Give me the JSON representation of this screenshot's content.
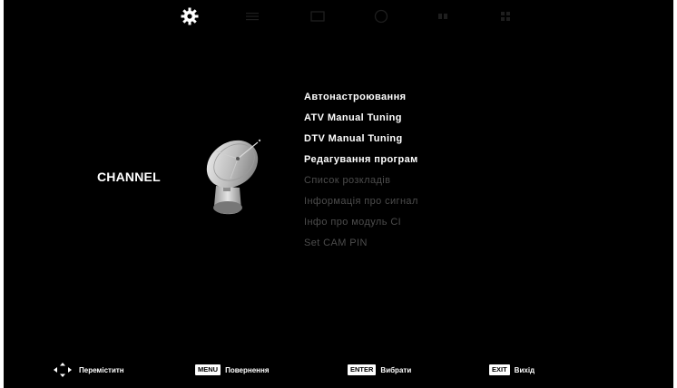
{
  "category": {
    "label": "CHANNEL"
  },
  "top_tabs": [
    {
      "icon": "gear-icon",
      "active": true
    },
    {
      "icon": "list-icon",
      "active": false
    },
    {
      "icon": "screen-icon",
      "active": false
    },
    {
      "icon": "circle-icon",
      "active": false
    },
    {
      "icon": "pair-icon",
      "active": false
    },
    {
      "icon": "grid-icon",
      "active": false
    }
  ],
  "menu": {
    "items": [
      {
        "label": "Автонастроювання",
        "enabled": true
      },
      {
        "label": "ATV Manual Tuning",
        "enabled": true
      },
      {
        "label": "DTV Manual Tuning",
        "enabled": true
      },
      {
        "label": "Редагування програм",
        "enabled": true
      },
      {
        "label": "Список розкладів",
        "enabled": false
      },
      {
        "label": "Інформація про сигнал",
        "enabled": false
      },
      {
        "label": "Інфо про модуль CI",
        "enabled": false
      },
      {
        "label": "Set CAM PIN",
        "enabled": false
      }
    ]
  },
  "footer": {
    "move": {
      "label": "Переміститн",
      "icon": "arrows-icon"
    },
    "menu": {
      "key": "MENU",
      "label": "Повернення"
    },
    "enter": {
      "key": "ENTER",
      "label": "Вибрати"
    },
    "exit": {
      "key": "EXIT",
      "label": "Вихід"
    }
  },
  "colors": {
    "background": "#000000",
    "active_text": "#ffffff",
    "inactive_text": "#4c4c4c"
  }
}
